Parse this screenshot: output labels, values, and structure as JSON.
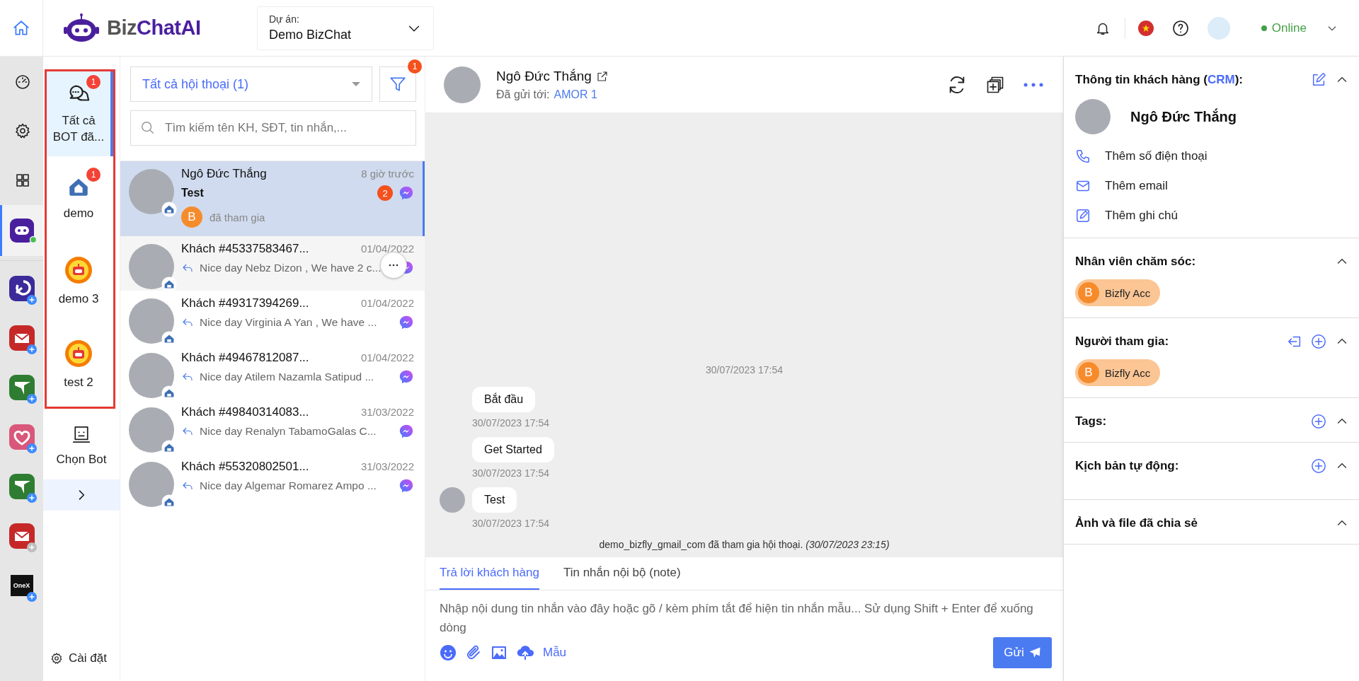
{
  "topbar": {
    "logo_prefix": "Biz",
    "logo_main": "ChatAI",
    "project": {
      "label": "Dự án:",
      "value": "Demo BizChat"
    },
    "status": {
      "label": "Online",
      "online": true
    }
  },
  "rail": {
    "items": [
      {
        "kind": "dashboard",
        "selected": false
      },
      {
        "kind": "settings",
        "selected": false
      },
      {
        "kind": "apps",
        "selected": false
      },
      {
        "kind": "bizchat",
        "selected": true
      }
    ],
    "apps": [
      {
        "kind": "flow",
        "enabled": true
      },
      {
        "kind": "mail",
        "enabled": true
      },
      {
        "kind": "plane",
        "enabled": true
      },
      {
        "kind": "heart",
        "enabled": true
      },
      {
        "kind": "plane",
        "enabled": true
      },
      {
        "kind": "mail",
        "enabled": false
      },
      {
        "kind": "text",
        "label": "OneX",
        "enabled": true
      }
    ]
  },
  "bots": {
    "items": [
      {
        "kind": "all",
        "label": "Tất cả BOT đã...",
        "badge": "1",
        "selected": true
      },
      {
        "kind": "home",
        "label": "demo",
        "badge": "1",
        "selected": false
      },
      {
        "kind": "robot",
        "label": "demo 3",
        "selected": false
      },
      {
        "kind": "robot",
        "label": "test 2",
        "selected": false
      }
    ],
    "choose": "Chọn Bot",
    "settings": "Cài đặt"
  },
  "conversations": {
    "filter": "Tất cả hội thoại (1)",
    "filter_badge": "1",
    "search_placeholder": "Tìm kiếm tên KH, SĐT, tin nhắn,...",
    "items": [
      {
        "kind": "incoming",
        "name": "Ngô Đức Thắng",
        "time": "8 giờ trước",
        "preview": "Test",
        "unread": "2",
        "joined": {
          "initial": "B",
          "text": "đã tham gia"
        },
        "selected": true,
        "hovered": false
      },
      {
        "kind": "reply",
        "name": "Khách #45337583467...",
        "time": "01/04/2022",
        "preview": "Nice day Nebz Dizon , We have 2 c...",
        "selected": false,
        "hovered": true
      },
      {
        "kind": "reply",
        "name": "Khách #49317394269...",
        "time": "01/04/2022",
        "preview": "Nice day Virginia A Yan , We have ...",
        "selected": false,
        "hovered": false
      },
      {
        "kind": "reply",
        "name": "Khách #49467812087...",
        "time": "01/04/2022",
        "preview": "Nice day Atilem Nazamla Satipud ...",
        "selected": false,
        "hovered": false
      },
      {
        "kind": "reply",
        "name": "Khách #49840314083...",
        "time": "31/03/2022",
        "preview": "Nice day Renalyn TabamoGalas C...",
        "selected": false,
        "hovered": false
      },
      {
        "kind": "reply",
        "name": "Khách #55320802501...",
        "time": "31/03/2022",
        "preview": "Nice day Algemar Romarez Ampo ...",
        "selected": false,
        "hovered": false
      }
    ]
  },
  "chat": {
    "name": "Ngô Đức Thắng",
    "sent_to_label": "Đã gửi tới:",
    "sent_to": "AMOR 1",
    "date": "30/07/2023 17:54",
    "messages": [
      {
        "text": "Bắt đầu",
        "time": "30/07/2023 17:54",
        "avatar": false
      },
      {
        "text": "Get Started",
        "time": "30/07/2023 17:54",
        "avatar": false
      },
      {
        "text": "Test",
        "time": "30/07/2023 17:54",
        "avatar": true
      }
    ],
    "system_note": "demo_bizfly_gmail_com đã tham gia hội thoại. *(30/07/2023 23:15)*",
    "tabs": [
      {
        "label": "Trả lời khách hàng",
        "selected": true
      },
      {
        "label": "Tin nhắn nội bộ (note)",
        "selected": false
      }
    ],
    "placeholder": "Nhập nội dung tin nhắn vào đây hoặc gõ / kèm phím tắt để hiện tin nhắn mẫu... Sử dụng Shift + Enter để xuống dòng",
    "template": "Mẫu",
    "send": "Gửi"
  },
  "crm": {
    "title": "Thông tin khách hàng (",
    "title_link": "CRM",
    "title_end": "):",
    "expanded": true,
    "customer": "Ngô Đức Thắng",
    "actions": [
      {
        "kind": "phone",
        "label": "Thêm số điện thoại"
      },
      {
        "kind": "email",
        "label": "Thêm email"
      },
      {
        "kind": "note",
        "label": "Thêm ghi chú"
      }
    ],
    "sections": [
      {
        "title": "Nhân viên chăm sóc:",
        "expanded": true,
        "chips": [
          {
            "initial": "B",
            "name": "Bizfly Acc"
          }
        ]
      },
      {
        "title": "Người tham gia:",
        "expanded": true,
        "can_leave": true,
        "can_add": true,
        "chips": [
          {
            "initial": "B",
            "name": "Bizfly Acc"
          }
        ]
      },
      {
        "title": "Tags:",
        "expanded": true,
        "can_add": true
      },
      {
        "title": "Kịch bản tự động:",
        "expanded": true,
        "can_add": true
      },
      {
        "title": "Ảnh và file đã chia sẻ",
        "expanded": true
      }
    ]
  }
}
